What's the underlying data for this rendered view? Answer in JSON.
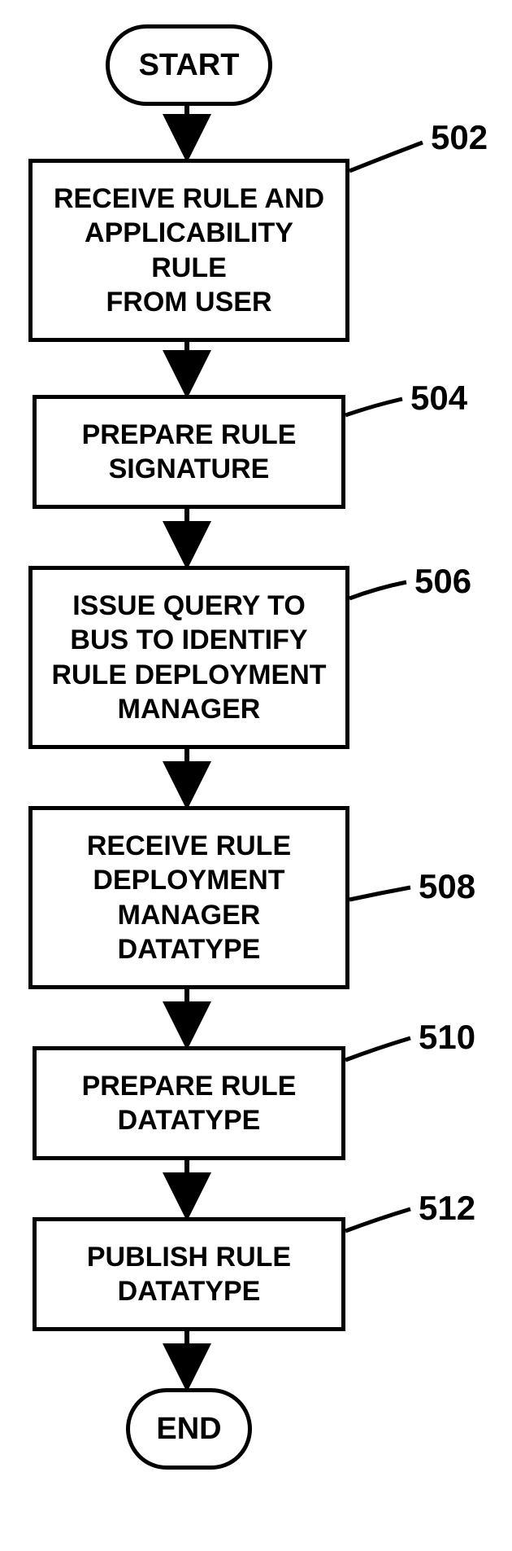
{
  "chart_data": {
    "type": "flowchart",
    "nodes": [
      {
        "id": "start",
        "kind": "terminator",
        "label": "START"
      },
      {
        "id": "502",
        "kind": "process",
        "label": "RECEIVE RULE AND APPLICABILITY RULE FROM USER",
        "ref": "502"
      },
      {
        "id": "504",
        "kind": "process",
        "label": "PREPARE RULE SIGNATURE",
        "ref": "504"
      },
      {
        "id": "506",
        "kind": "process",
        "label": "ISSUE QUERY TO BUS TO IDENTIFY RULE DEPLOYMENT MANAGER",
        "ref": "506"
      },
      {
        "id": "508",
        "kind": "process",
        "label": "RECEIVE RULE DEPLOYMENT MANAGER DATATYPE",
        "ref": "508"
      },
      {
        "id": "510",
        "kind": "process",
        "label": "PREPARE RULE DATATYPE",
        "ref": "510"
      },
      {
        "id": "512",
        "kind": "process",
        "label": "PUBLISH RULE DATATYPE",
        "ref": "512"
      },
      {
        "id": "end",
        "kind": "terminator",
        "label": "END"
      }
    ],
    "edges": [
      [
        "start",
        "502"
      ],
      [
        "502",
        "504"
      ],
      [
        "504",
        "506"
      ],
      [
        "506",
        "508"
      ],
      [
        "508",
        "510"
      ],
      [
        "510",
        "512"
      ],
      [
        "512",
        "end"
      ]
    ]
  },
  "start": {
    "label": "START"
  },
  "end": {
    "label": "END"
  },
  "steps": {
    "s502": {
      "text": "RECEIVE RULE AND\nAPPLICABILITY\nRULE\nFROM USER",
      "ref": "502"
    },
    "s504": {
      "text": "PREPARE RULE\nSIGNATURE",
      "ref": "504"
    },
    "s506": {
      "text": "ISSUE QUERY TO\nBUS TO IDENTIFY\nRULE DEPLOYMENT\nMANAGER",
      "ref": "506"
    },
    "s508": {
      "text": "RECEIVE RULE\nDEPLOYMENT\nMANAGER\nDATATYPE",
      "ref": "508"
    },
    "s510": {
      "text": "PREPARE RULE\nDATATYPE",
      "ref": "510"
    },
    "s512": {
      "text": "PUBLISH RULE\nDATATYPE",
      "ref": "512"
    }
  }
}
